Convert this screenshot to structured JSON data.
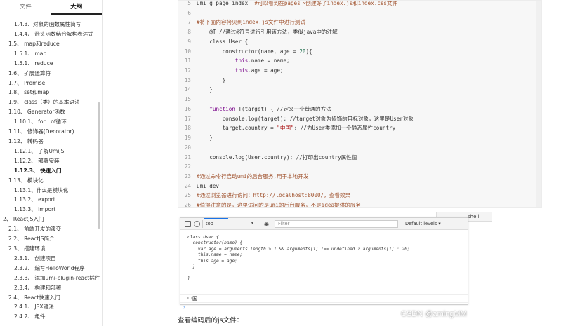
{
  "sidebar": {
    "tabs": [
      {
        "label": "文件"
      },
      {
        "label": "大纲"
      }
    ],
    "items": [
      {
        "label": "1.4.3、对象的函数属性简写",
        "level": 3
      },
      {
        "label": "1.4.4、 箭头函数结合解构表达式",
        "level": 3,
        "wrap": true
      },
      {
        "label": "1.5、 map和reduce",
        "level": 2
      },
      {
        "label": "1.5.1、 map",
        "level": 3
      },
      {
        "label": "1.5.1、 reduce",
        "level": 3
      },
      {
        "label": "1.6、 扩展运算符",
        "level": 2
      },
      {
        "label": "1.7、 Promise",
        "level": 2
      },
      {
        "label": "1.8、 set和map",
        "level": 2
      },
      {
        "label": "1.9、 class（类）的基本语法",
        "level": 2
      },
      {
        "label": "1.10、 Generator函数",
        "level": 2
      },
      {
        "label": "1.10.1、 for…of循环",
        "level": 3
      },
      {
        "label": "1.11、 修饰器(Decorator)",
        "level": 2
      },
      {
        "label": "1.12、 转码器",
        "level": 2
      },
      {
        "label": "1.12.1、 了解UmiJS",
        "level": 3
      },
      {
        "label": "1.12.2、 部署安装",
        "level": 3
      },
      {
        "label": "1.12.3、 快速入门",
        "level": 3,
        "active": true
      },
      {
        "label": "1.13、 模块化",
        "level": 2
      },
      {
        "label": "1.13.1、什么是模块化",
        "level": 3
      },
      {
        "label": "1.13.2、 export",
        "level": 3
      },
      {
        "label": "1.13.3、 import",
        "level": 3
      },
      {
        "label": "2、 ReactJS入门",
        "level": 1
      },
      {
        "label": "2.1、 前端开发的演变",
        "level": 2
      },
      {
        "label": "2.2、 ReactJS简介",
        "level": 2
      },
      {
        "label": "2.3、 搭建环境",
        "level": 2
      },
      {
        "label": "2.3.1、 创建项目",
        "level": 3
      },
      {
        "label": "2.3.2、 编写HelloWorld程序",
        "level": 3
      },
      {
        "label": "2.3.3、 添加umi-plugin-react插件",
        "level": 3,
        "wrap": true
      },
      {
        "label": "2.3.4、 构建和部署",
        "level": 3
      },
      {
        "label": "2.4、 React快速入门",
        "level": 2
      },
      {
        "label": "2.4.1、 JSX语法",
        "level": 3
      },
      {
        "label": "2.4.2、 组件",
        "level": 3
      }
    ]
  },
  "code": {
    "lines": [
      {
        "n": "5",
        "segs": [
          {
            "t": "umi g page index  ",
            "c": ""
          },
          {
            "t": "#可以看到在pages下创建好了index.js和index.css文件",
            "c": "c-comment"
          }
        ]
      },
      {
        "n": "6",
        "segs": []
      },
      {
        "n": "7",
        "segs": [
          {
            "t": "#将下面内容拷贝到index.js文件中进行测试",
            "c": "c-comment"
          }
        ]
      },
      {
        "n": "8",
        "segs": [
          {
            "t": "    @T //通过@符号进行引用该方法，类似java中的注解",
            "c": ""
          }
        ]
      },
      {
        "n": "9",
        "segs": [
          {
            "t": "    class User {",
            "c": ""
          }
        ]
      },
      {
        "n": "10",
        "segs": [
          {
            "t": "        constructor(name, age = ",
            "c": ""
          },
          {
            "t": "20",
            "c": "c-num"
          },
          {
            "t": "){",
            "c": ""
          }
        ]
      },
      {
        "n": "11",
        "segs": [
          {
            "t": "            ",
            "c": ""
          },
          {
            "t": "this",
            "c": "c-kw"
          },
          {
            "t": ".name = name;",
            "c": ""
          }
        ]
      },
      {
        "n": "12",
        "segs": [
          {
            "t": "            ",
            "c": ""
          },
          {
            "t": "this",
            "c": "c-kw"
          },
          {
            "t": ".age = age;",
            "c": ""
          }
        ]
      },
      {
        "n": "13",
        "segs": [
          {
            "t": "        }",
            "c": ""
          }
        ]
      },
      {
        "n": "14",
        "segs": [
          {
            "t": "    }",
            "c": ""
          }
        ]
      },
      {
        "n": "15",
        "segs": []
      },
      {
        "n": "16",
        "segs": [
          {
            "t": "    ",
            "c": ""
          },
          {
            "t": "function",
            "c": "c-kw"
          },
          {
            "t": " T(target) { //定义一个普通的方法",
            "c": ""
          }
        ]
      },
      {
        "n": "17",
        "segs": [
          {
            "t": "        console.log(target); //target对象为修饰的目标对象，这里是User对象",
            "c": ""
          }
        ]
      },
      {
        "n": "18",
        "segs": [
          {
            "t": "        target.country = ",
            "c": ""
          },
          {
            "t": "\"中国\"",
            "c": "c-str"
          },
          {
            "t": "; //为User类添加一个静态属性country",
            "c": ""
          }
        ]
      },
      {
        "n": "19",
        "segs": [
          {
            "t": "    }",
            "c": ""
          }
        ]
      },
      {
        "n": "20",
        "segs": []
      },
      {
        "n": "21",
        "segs": [
          {
            "t": "    console.log(User.country); //打印出country属性值",
            "c": ""
          }
        ]
      },
      {
        "n": "22",
        "segs": []
      },
      {
        "n": "23",
        "segs": [
          {
            "t": "#通过命令行启动umi的后台服务,用于本地开发",
            "c": "c-comment"
          }
        ]
      },
      {
        "n": "24",
        "segs": [
          {
            "t": "umi dev",
            "c": ""
          }
        ]
      },
      {
        "n": "25",
        "segs": [
          {
            "t": "#通过浏览器进行访问：http://localhost:8000/，查看效果",
            "c": "c-comment"
          }
        ]
      },
      {
        "n": "26",
        "segs": [
          {
            "t": "#值得注意的是，这里访问的是umi的后台服务，不是idea提供的服务",
            "c": "c-comment"
          }
        ]
      }
    ]
  },
  "shell_tip": "shell",
  "console": {
    "context": "top",
    "filter_placeholder": "Filter",
    "levels": "Default levels ▾",
    "code_lines": [
      "class User {",
      "  constructor(name) {",
      "    var age = arguments.length > 1 && arguments[1] !== undefined ? arguments[1] : 20;",
      "    this.name = name;",
      "    this.age = age;",
      "  }",
      "",
      "}"
    ],
    "output": "中国",
    "prompt": "›"
  },
  "bottom_text": "查看编码后的js文件：",
  "watermark": "CSDN @amingMM"
}
